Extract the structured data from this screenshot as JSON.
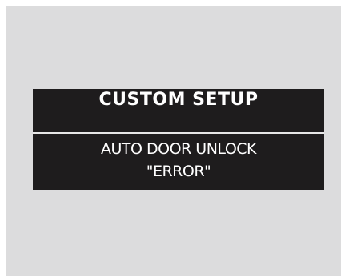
{
  "display": {
    "title": "CUSTOM SETUP",
    "line1": "AUTO DOOR UNLOCK",
    "line2": "\"ERROR\""
  }
}
